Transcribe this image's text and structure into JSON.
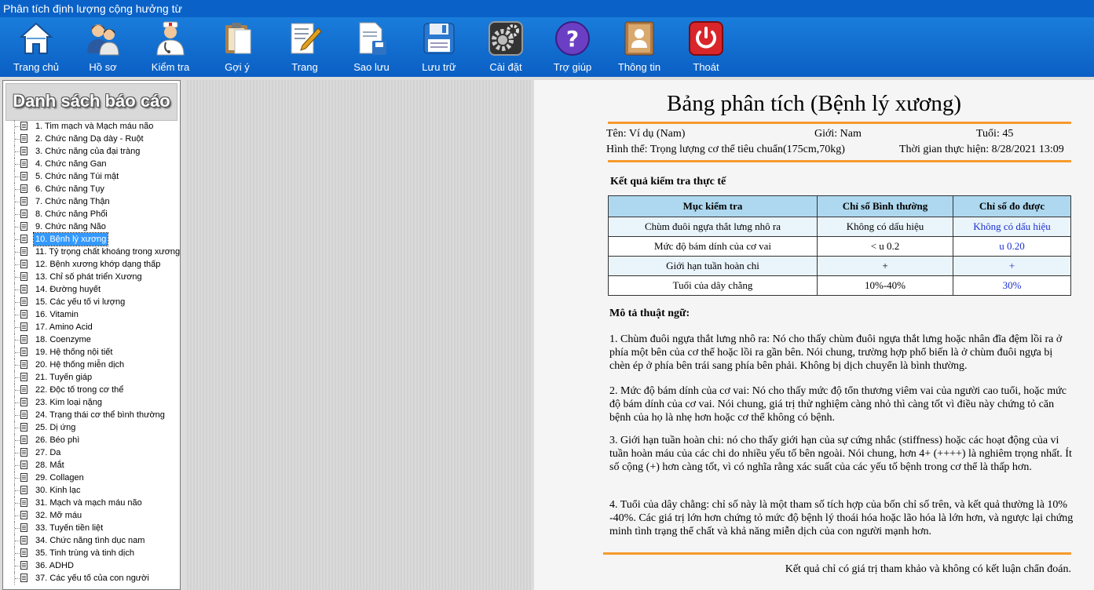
{
  "window": {
    "title": "Phân tích định lượng cộng hưởng từ"
  },
  "toolbar": [
    {
      "id": "home",
      "label": "Trang chủ",
      "icon": "home-icon"
    },
    {
      "id": "profile",
      "label": "Hồ sơ",
      "icon": "users-icon"
    },
    {
      "id": "check",
      "label": "Kiểm tra",
      "icon": "doctor-icon"
    },
    {
      "id": "suggest",
      "label": "Gợi ý",
      "icon": "clipboard-icon"
    },
    {
      "id": "page",
      "label": "Trang",
      "icon": "edit-document-icon"
    },
    {
      "id": "backup",
      "label": "Sao lưu",
      "icon": "document-save-icon"
    },
    {
      "id": "store",
      "label": "Lưu trữ",
      "icon": "floppy-icon"
    },
    {
      "id": "settings",
      "label": "Cài đặt",
      "icon": "gear-icon"
    },
    {
      "id": "help",
      "label": "Trợ giúp",
      "icon": "help-icon"
    },
    {
      "id": "info",
      "label": "Thông tin",
      "icon": "contact-book-icon"
    },
    {
      "id": "exit",
      "label": "Thoát",
      "icon": "power-icon"
    }
  ],
  "sidebar": {
    "title": "Danh sách báo cáo",
    "selected_index": 9,
    "items": [
      "1. Tim mạch và Mạch máu não",
      "2. Chức năng Dạ dày - Ruột",
      "3. Chức năng của đại tràng",
      "4. Chức năng Gan",
      "5. Chức năng Túi mật",
      "6. Chức năng Tụy",
      "7. Chức năng Thận",
      "8. Chức năng Phổi",
      "9. Chức năng Não",
      "10. Bệnh lý xương",
      "11. Tỷ trọng chất khoáng trong xương",
      "12. Bệnh xương khớp dạng thấp",
      "13. Chỉ số phát triển Xương",
      "14. Đường huyết",
      "15. Các yếu tố vi lượng",
      "16. Vitamin",
      "17. Amino Acid",
      "18. Coenzyme",
      "19. Hệ thống nội tiết",
      "20. Hệ thống miễn dịch",
      "21. Tuyến giáp",
      "22. Độc tố trong cơ thể",
      "23. Kim loại nặng",
      "24. Trạng thái cơ thể bình thường",
      "25. Dị ứng",
      "26. Béo phì",
      "27. Da",
      "28. Mắt",
      "29. Collagen",
      "30. Kinh lạc",
      "31. Mạch và mạch máu não",
      "32. Mỡ máu",
      "33. Tuyến tiền liệt",
      "34. Chức năng tình dục nam",
      "35. Tinh trùng và tinh dịch",
      "36. ADHD",
      "37. Các yếu tố của con người"
    ]
  },
  "report": {
    "title": "Bảng phân tích (Bệnh lý xương)",
    "name": "Tên: Ví dụ (Nam)",
    "gender": "Giới: Nam",
    "age": "Tuổi: 45",
    "body": "Hình thể: Trọng lượng cơ thể tiêu chuẩn(175cm,70kg)",
    "time": "Thời gian thực hiện: 8/28/2021 13:09",
    "results_title": "Kết quả kiểm tra thực tế",
    "table": {
      "headers": [
        "Mục kiểm tra",
        "Chỉ số Bình thường",
        "Chỉ số đo được"
      ],
      "rows": [
        [
          "Chùm đuôi ngựa thắt lưng nhô ra",
          "Không có dấu hiệu",
          "Không có dấu hiệu"
        ],
        [
          "Mức độ bám dính của cơ vai",
          "< u 0.2",
          "u 0.20"
        ],
        [
          "Giới hạn tuần hoàn chi",
          "+",
          "+"
        ],
        [
          "Tuổi của dây chằng",
          "10%-40%",
          "30%"
        ]
      ]
    },
    "terms_title": "Mô tả thuật ngữ:",
    "terms": [
      "1. Chùm đuôi ngựa thắt lưng nhô ra: Nó cho thấy chùm đuôi ngựa thắt lưng hoặc nhân đĩa đệm lồi ra ở phía một bên của cơ thể hoặc lồi ra gần bên. Nói chung, trường hợp phổ biến là ở chùm đuôi ngựa bị chèn ép ở phía bên trái sang phía bên phải. Không bị dịch chuyển là bình thường.",
      "2. Mức độ bám dính của cơ vai: Nó cho thấy mức độ tổn thương viêm vai của người cao tuổi, hoặc mức độ bám dính của cơ vai. Nói chung, giá trị thử nghiệm càng nhỏ thì càng tốt vì điều này chứng tỏ căn bệnh của họ là nhẹ hơn hoặc cơ thể không có bệnh.",
      "3. Giới hạn tuần hoàn chi: nó cho thấy giới hạn của sự cứng nhắc (stiffness) hoặc các hoạt động của vi tuần hoàn máu của các chi do nhiều yếu tố bên ngoài. Nói chung, hơn 4+ (++++) là nghiêm trọng nhất. Ít số cộng (+) hơn càng tốt, vì có nghĩa rằng xác suất của các yếu tố bệnh trong cơ thể là thấp hơn.",
      "4. Tuổi của dây chằng: chỉ số này là một tham số tích hợp của bốn chỉ số trên, và kết quả thường là 10% -40%. Các giá trị lớn hơn chứng tỏ mức độ bệnh lý thoái hóa hoặc lão hóa là lớn hơn, và ngược lại chứng minh tình trạng thể chất và khả năng miễn dịch của con người mạnh hơn."
    ],
    "footer": "Kết quả chỉ có giá trị tham khảo và không có kết luận chẩn đoán."
  }
}
